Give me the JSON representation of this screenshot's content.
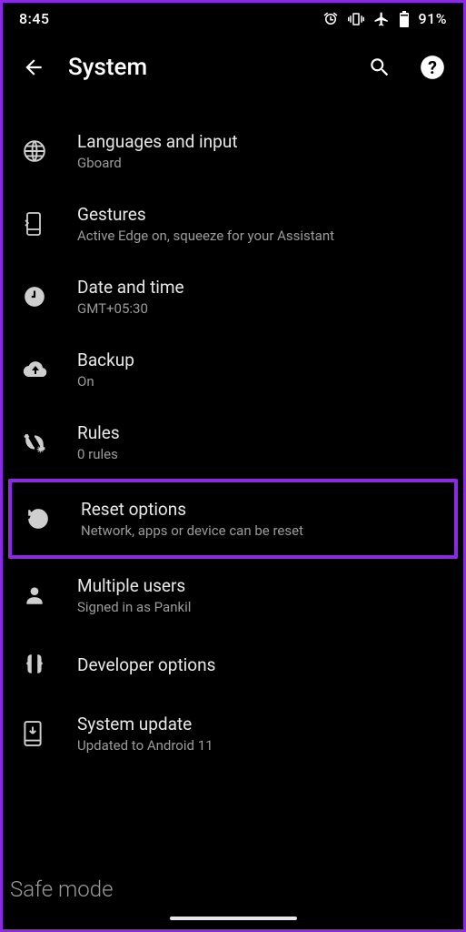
{
  "status": {
    "time": "8:45",
    "battery_pct": "91%"
  },
  "header": {
    "title": "System"
  },
  "items": [
    {
      "icon": "globe-icon",
      "title": "Languages and input",
      "sub": "Gboard"
    },
    {
      "icon": "gesture-icon",
      "title": "Gestures",
      "sub": "Active Edge on, squeeze for your Assistant"
    },
    {
      "icon": "clock-icon",
      "title": "Date and time",
      "sub": "GMT+05:30"
    },
    {
      "icon": "backup-icon",
      "title": "Backup",
      "sub": "On"
    },
    {
      "icon": "rules-icon",
      "title": "Rules",
      "sub": "0 rules"
    },
    {
      "icon": "reset-icon",
      "title": "Reset options",
      "sub": "Network, apps or device can be reset",
      "highlight": true
    },
    {
      "icon": "user-icon",
      "title": "Multiple users",
      "sub": "Signed in as Pankil"
    },
    {
      "icon": "braces-icon",
      "title": "Developer options",
      "sub": ""
    },
    {
      "icon": "update-icon",
      "title": "System update",
      "sub": "Updated to Android 11"
    }
  ],
  "footer": {
    "safe_mode": "Safe mode"
  }
}
